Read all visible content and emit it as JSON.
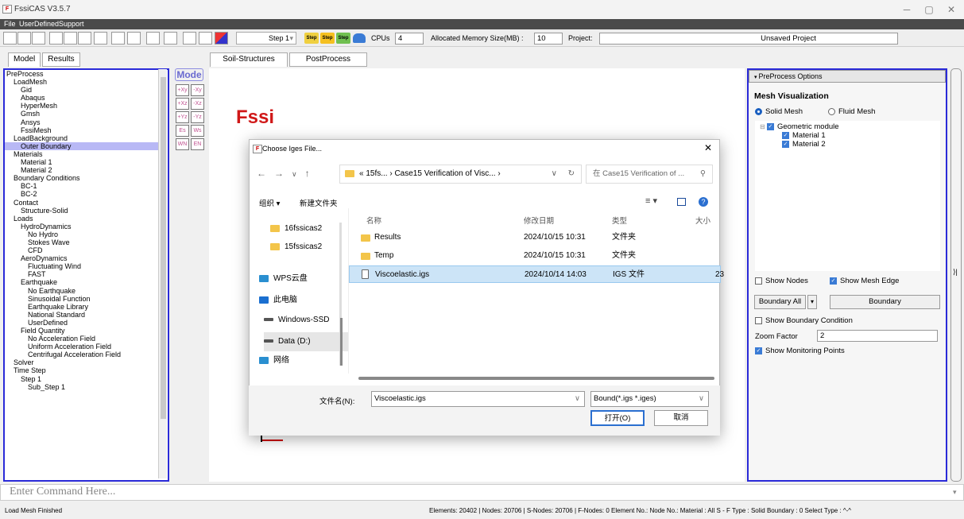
{
  "window": {
    "title": "FssiCAS V3.5.7",
    "controls": [
      "─",
      "▢",
      "✕"
    ]
  },
  "menu": [
    "File",
    "UserDefined",
    "Support"
  ],
  "toolbar": {
    "step_select": "Step 1",
    "step_icons": [
      "Step",
      "Step",
      "Step"
    ],
    "cpus_label": "CPUs",
    "cpus_value": "4",
    "memory_label": "Allocated Memory Size(MB) :",
    "memory_value": "10",
    "project_label": "Project:",
    "project_value": "Unsaved Project"
  },
  "left_tabs": [
    "Model",
    "Results"
  ],
  "canvas_tabs": [
    "Soil-Structures",
    "PostProcess"
  ],
  "tree": [
    {
      "t": "PreProcess",
      "d": 0
    },
    {
      "t": "LoadMesh",
      "d": 1
    },
    {
      "t": "Gid",
      "d": 2
    },
    {
      "t": "Abaqus",
      "d": 2
    },
    {
      "t": "HyperMesh",
      "d": 2
    },
    {
      "t": "Gmsh",
      "d": 2
    },
    {
      "t": "Ansys",
      "d": 2
    },
    {
      "t": "FssiMesh",
      "d": 2
    },
    {
      "t": "LoadBackground",
      "d": 1
    },
    {
      "t": "Outer Boundary",
      "d": 2,
      "sel": true
    },
    {
      "t": "Materials",
      "d": 1
    },
    {
      "t": "Material 1",
      "d": 2
    },
    {
      "t": "Material 2",
      "d": 2
    },
    {
      "t": "Boundary Conditions",
      "d": 1
    },
    {
      "t": "BC-1",
      "d": 2
    },
    {
      "t": "BC-2",
      "d": 2
    },
    {
      "t": "Contact",
      "d": 1
    },
    {
      "t": "Structure-Solid",
      "d": 2
    },
    {
      "t": "Loads",
      "d": 1
    },
    {
      "t": "HydroDynamics",
      "d": 2
    },
    {
      "t": "No Hydro",
      "d": 3
    },
    {
      "t": "Stokes Wave",
      "d": 3
    },
    {
      "t": "CFD",
      "d": 3
    },
    {
      "t": "AeroDynamics",
      "d": 2
    },
    {
      "t": "Fluctuating Wind",
      "d": 3
    },
    {
      "t": "FAST",
      "d": 3
    },
    {
      "t": "Earthquake",
      "d": 2
    },
    {
      "t": "No Earthquake",
      "d": 3
    },
    {
      "t": "Sinusoidal Function",
      "d": 3
    },
    {
      "t": "Earthquake Library",
      "d": 3
    },
    {
      "t": "National Standard",
      "d": 3
    },
    {
      "t": "UserDefined",
      "d": 3
    },
    {
      "t": "Field Quantity",
      "d": 2
    },
    {
      "t": "No Acceleration Field",
      "d": 3
    },
    {
      "t": "Uniform Acceleration Field",
      "d": 3
    },
    {
      "t": "Centrifugal Acceleration Field",
      "d": 3
    },
    {
      "t": "Solver",
      "d": 1
    },
    {
      "t": "Time Step",
      "d": 1
    },
    {
      "t": "Step 1",
      "d": 2
    },
    {
      "t": "Sub_Step 1",
      "d": 3
    }
  ],
  "mode_button": "Mode",
  "mode_icons": [
    "+Xy",
    "-Xy",
    "+Xz",
    "-Xz",
    "+Yz",
    "-Yz",
    "Es",
    "Ws",
    "WN",
    "EN"
  ],
  "logo": "Fssi",
  "dialog": {
    "title": "Choose Iges File...",
    "close": "✕",
    "address": "« 15fs...  ›  Case15 Verification of Visc...  ›",
    "search_placeholder": "在 Case15 Verification of ...",
    "organize": "组织 ▾",
    "new_folder": "新建文件夹",
    "sidebar": [
      "16fssicas2",
      "15fssicas2",
      "WPS云盘",
      "此电脑",
      "Windows-SSD",
      "Data (D:)",
      "网络"
    ],
    "headers": [
      "名称",
      "修改日期",
      "类型",
      "大小"
    ],
    "files": [
      {
        "name": "Results",
        "date": "2024/10/15 10:31",
        "type": "文件夹",
        "size": "",
        "sel": false
      },
      {
        "name": "Temp",
        "date": "2024/10/15 10:31",
        "type": "文件夹",
        "size": "",
        "sel": false
      },
      {
        "name": "Viscoelastic.igs",
        "date": "2024/10/14 14:03",
        "type": "IGS 文件",
        "size": "23",
        "sel": true
      }
    ],
    "filename_label": "文件名(N):",
    "filename_value": "Viscoelastic.igs",
    "filter": "Bound(*.igs *.iges)",
    "open": "打开(O)",
    "cancel": "取消"
  },
  "right_panel": {
    "header": "PreProcess Options",
    "title": "Mesh Visualization",
    "solid": "Solid Mesh",
    "fluid": "Fluid Mesh",
    "geo_module": "Geometric module",
    "materials": [
      "Material 1",
      "Material 2"
    ],
    "show_nodes": "Show Nodes",
    "show_mesh_edge": "Show Mesh Edge",
    "boundary_all": "Boundary All",
    "boundary": "Boundary",
    "show_bc": "Show Boundary Condition",
    "zoom_label": "Zoom Factor",
    "zoom_value": "2",
    "show_mp": "Show Monitoring Points"
  },
  "command_placeholder": "Enter Command Here...",
  "status": {
    "left": "Load Mesh Finished",
    "right": "Elements: 20402 | Nodes: 20706 | S-Nodes: 20706 | F-Nodes: 0  Element No.:   Node No.:   Material : All   S - F Type : Solid   Boundary : 0   Select Type : ^-^"
  }
}
